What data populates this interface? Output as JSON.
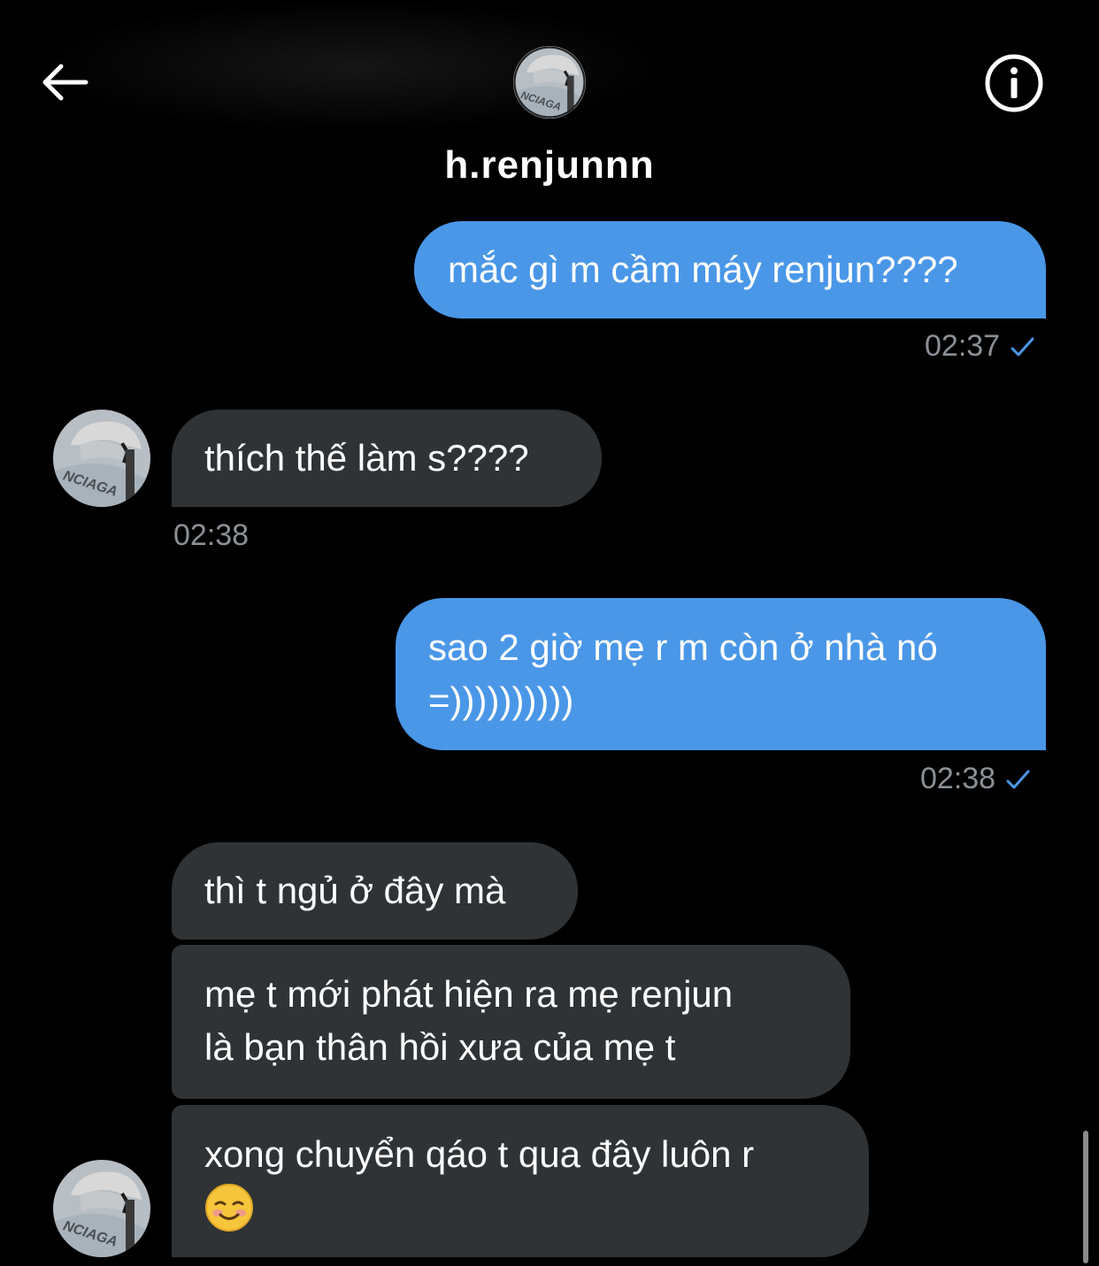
{
  "header": {
    "username": "h.renjunnn",
    "back_icon": "arrow-left-icon",
    "info_icon": "info-circle-icon"
  },
  "messages": [
    {
      "id": "m1",
      "direction": "sent",
      "text": "mắc gì m cầm máy renjun????",
      "time": "02:37",
      "status": "sent-check"
    },
    {
      "id": "m2",
      "direction": "received",
      "text": "thích thế làm s????",
      "time": "02:38"
    },
    {
      "id": "m3",
      "direction": "sent",
      "line1": "sao 2 giờ mẹ r m còn ở nhà nó",
      "line2": "=))))))))))",
      "time": "02:38",
      "status": "sent-check"
    },
    {
      "id": "m4",
      "direction": "received",
      "text": "thì t ngủ ở đây mà"
    },
    {
      "id": "m5",
      "direction": "received",
      "line1": "mẹ t mới phát hiện ra mẹ renjun",
      "line2": "là bạn thân hồi xưa của mẹ t"
    },
    {
      "id": "m6",
      "direction": "received",
      "line1": "xong chuyển qáo t qua đây luôn r",
      "emoji": "smiling-face-icon"
    }
  ],
  "colors": {
    "background": "#000000",
    "sent_bubble": "#4a97e8",
    "received_bubble": "#2f3336",
    "timestamp": "#8b9096",
    "check": "#4a97e8"
  }
}
